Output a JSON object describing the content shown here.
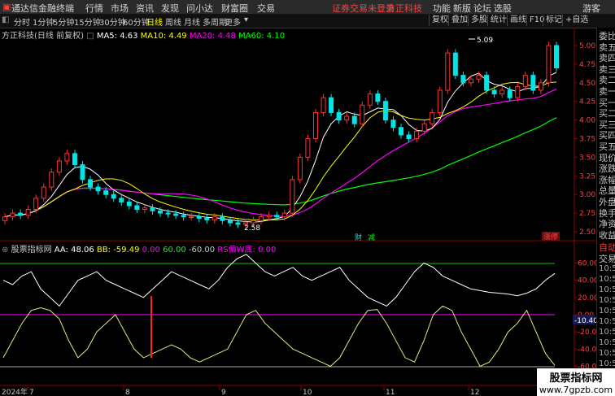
{
  "menu": {
    "app_title": "通达信金融终端",
    "items": [
      "行情",
      "市场",
      "资讯",
      "发现",
      "问小达",
      "财富圈",
      "交易"
    ],
    "notice": "证券交易未登录",
    "broker": "方正科技",
    "right_items": [
      "功能",
      "新版",
      "论坛",
      "选股"
    ],
    "guest": "游客"
  },
  "toolbar": {
    "periods": [
      "分时",
      "1分钟",
      "5分钟",
      "15分钟",
      "30分钟",
      "60分钟",
      "日线",
      "周线",
      "月线",
      "多周期",
      "更多"
    ],
    "active_period": "日线",
    "tools": [
      "复权",
      "叠加",
      "多股",
      "统计",
      "画线",
      "F10",
      "标记",
      "+自选"
    ]
  },
  "chart_header": {
    "title": "方正科技(日线 前复权)",
    "ma5": "MA5: 4.63",
    "ma10": "MA10: 4.49",
    "ma20": "MA20: 4.48",
    "ma60": "MA60: 4.10"
  },
  "indicator_header": {
    "name": "股票指标网",
    "aa": "AA: 48.06",
    "bb": "BB: -59.49",
    "v1": "0.00",
    "v2": "60.00",
    "v3": "-60.00",
    "rs": "RS偏W底: 0.00"
  },
  "right_column": {
    "quote_labels": [
      "委比",
      "卖五",
      "卖四",
      "卖三",
      "卖二",
      "卖一",
      "买一",
      "买二",
      "买三",
      "买四",
      "买五",
      "现价",
      "涨跌",
      "涨幅",
      "总量",
      "外盘",
      "换手",
      "净资",
      "收益"
    ],
    "trade_labels": [
      "自动",
      "交易"
    ],
    "times": [
      "10:58",
      "10:58",
      "10:58",
      "10:58",
      "10:58",
      "10:58",
      "10:58",
      "10:58",
      "10:58",
      "10:58",
      "10:58",
      "10:58"
    ]
  },
  "price_axis": {
    "ticks": [
      "5.00",
      "4.75",
      "4.50",
      "4.25",
      "4.00",
      "3.75",
      "3.50",
      "3.25",
      "3.00",
      "2.75",
      "2.50"
    ],
    "high_label": "5.09",
    "low_label": "2.58",
    "fin_label": "财",
    "jian_label": "减",
    "zhang_label": "涨停"
  },
  "indicator_axis": {
    "ticks": [
      "60.00",
      "40.00",
      "20.00",
      "0.00",
      "-20.00",
      "-40.00",
      "-60.00"
    ],
    "marker": "-10.40"
  },
  "date_axis": {
    "labels": [
      "2024年",
      "7",
      "8",
      "9",
      "10",
      "11",
      "12"
    ]
  },
  "watermark": {
    "title": "股票指标网",
    "url": "www.7gpzb.com"
  },
  "colors": {
    "up": "#ff3232",
    "down": "#00e5e5",
    "ma5": "#ffffff",
    "ma10": "#ffff00",
    "ma20": "#ff00ff",
    "ma60": "#00ff00"
  },
  "chart_data": {
    "type": "candlestick",
    "x_labels": [
      "7",
      "8",
      "9",
      "10",
      "11",
      "12"
    ],
    "ylim": [
      2.45,
      5.2
    ],
    "close": [
      2.7,
      2.75,
      2.72,
      2.8,
      2.95,
      3.1,
      3.3,
      3.45,
      3.55,
      3.4,
      3.2,
      3.1,
      3.05,
      3.0,
      2.95,
      2.9,
      2.85,
      2.8,
      2.82,
      2.78,
      2.75,
      2.74,
      2.72,
      2.7,
      2.7,
      2.68,
      2.66,
      2.7,
      2.65,
      2.62,
      2.6,
      2.62,
      2.65,
      2.7,
      2.72,
      2.7,
      2.75,
      3.2,
      3.5,
      3.75,
      4.1,
      4.3,
      4.1,
      4.0,
      4.05,
      3.95,
      4.2,
      4.35,
      4.25,
      4.0,
      3.9,
      3.8,
      3.75,
      3.85,
      3.95,
      4.1,
      4.4,
      4.9,
      4.6,
      4.5,
      4.55,
      4.6,
      4.4,
      4.35,
      4.4,
      4.3,
      4.45,
      4.6,
      4.4,
      4.5,
      5.0,
      4.7
    ],
    "aa": [
      40,
      35,
      45,
      50,
      30,
      20,
      10,
      25,
      40,
      45,
      50,
      40,
      35,
      30,
      25,
      20,
      30,
      40,
      50,
      45,
      40,
      35,
      30,
      40,
      55,
      65,
      70,
      60,
      50,
      45,
      50,
      55,
      45,
      40,
      45,
      50,
      55,
      40,
      30,
      20,
      15,
      10,
      20,
      35,
      50,
      60,
      55,
      45,
      40,
      35,
      30,
      28,
      26,
      25,
      24,
      22,
      25,
      30,
      40,
      48
    ],
    "bb": [
      -50,
      -30,
      -10,
      5,
      8,
      5,
      -5,
      -30,
      -50,
      -40,
      -20,
      -10,
      0,
      -20,
      -40,
      -50,
      -45,
      -40,
      -35,
      -40,
      -50,
      -55,
      -50,
      -45,
      -40,
      -20,
      0,
      5,
      -10,
      -20,
      -30,
      -40,
      -45,
      -50,
      -55,
      -60,
      -50,
      -30,
      -10,
      5,
      6,
      -10,
      -30,
      -50,
      -55,
      -30,
      0,
      10,
      5,
      -20,
      -40,
      -60,
      -55,
      -40,
      -20,
      -10,
      5,
      -20,
      -45,
      -59
    ]
  }
}
